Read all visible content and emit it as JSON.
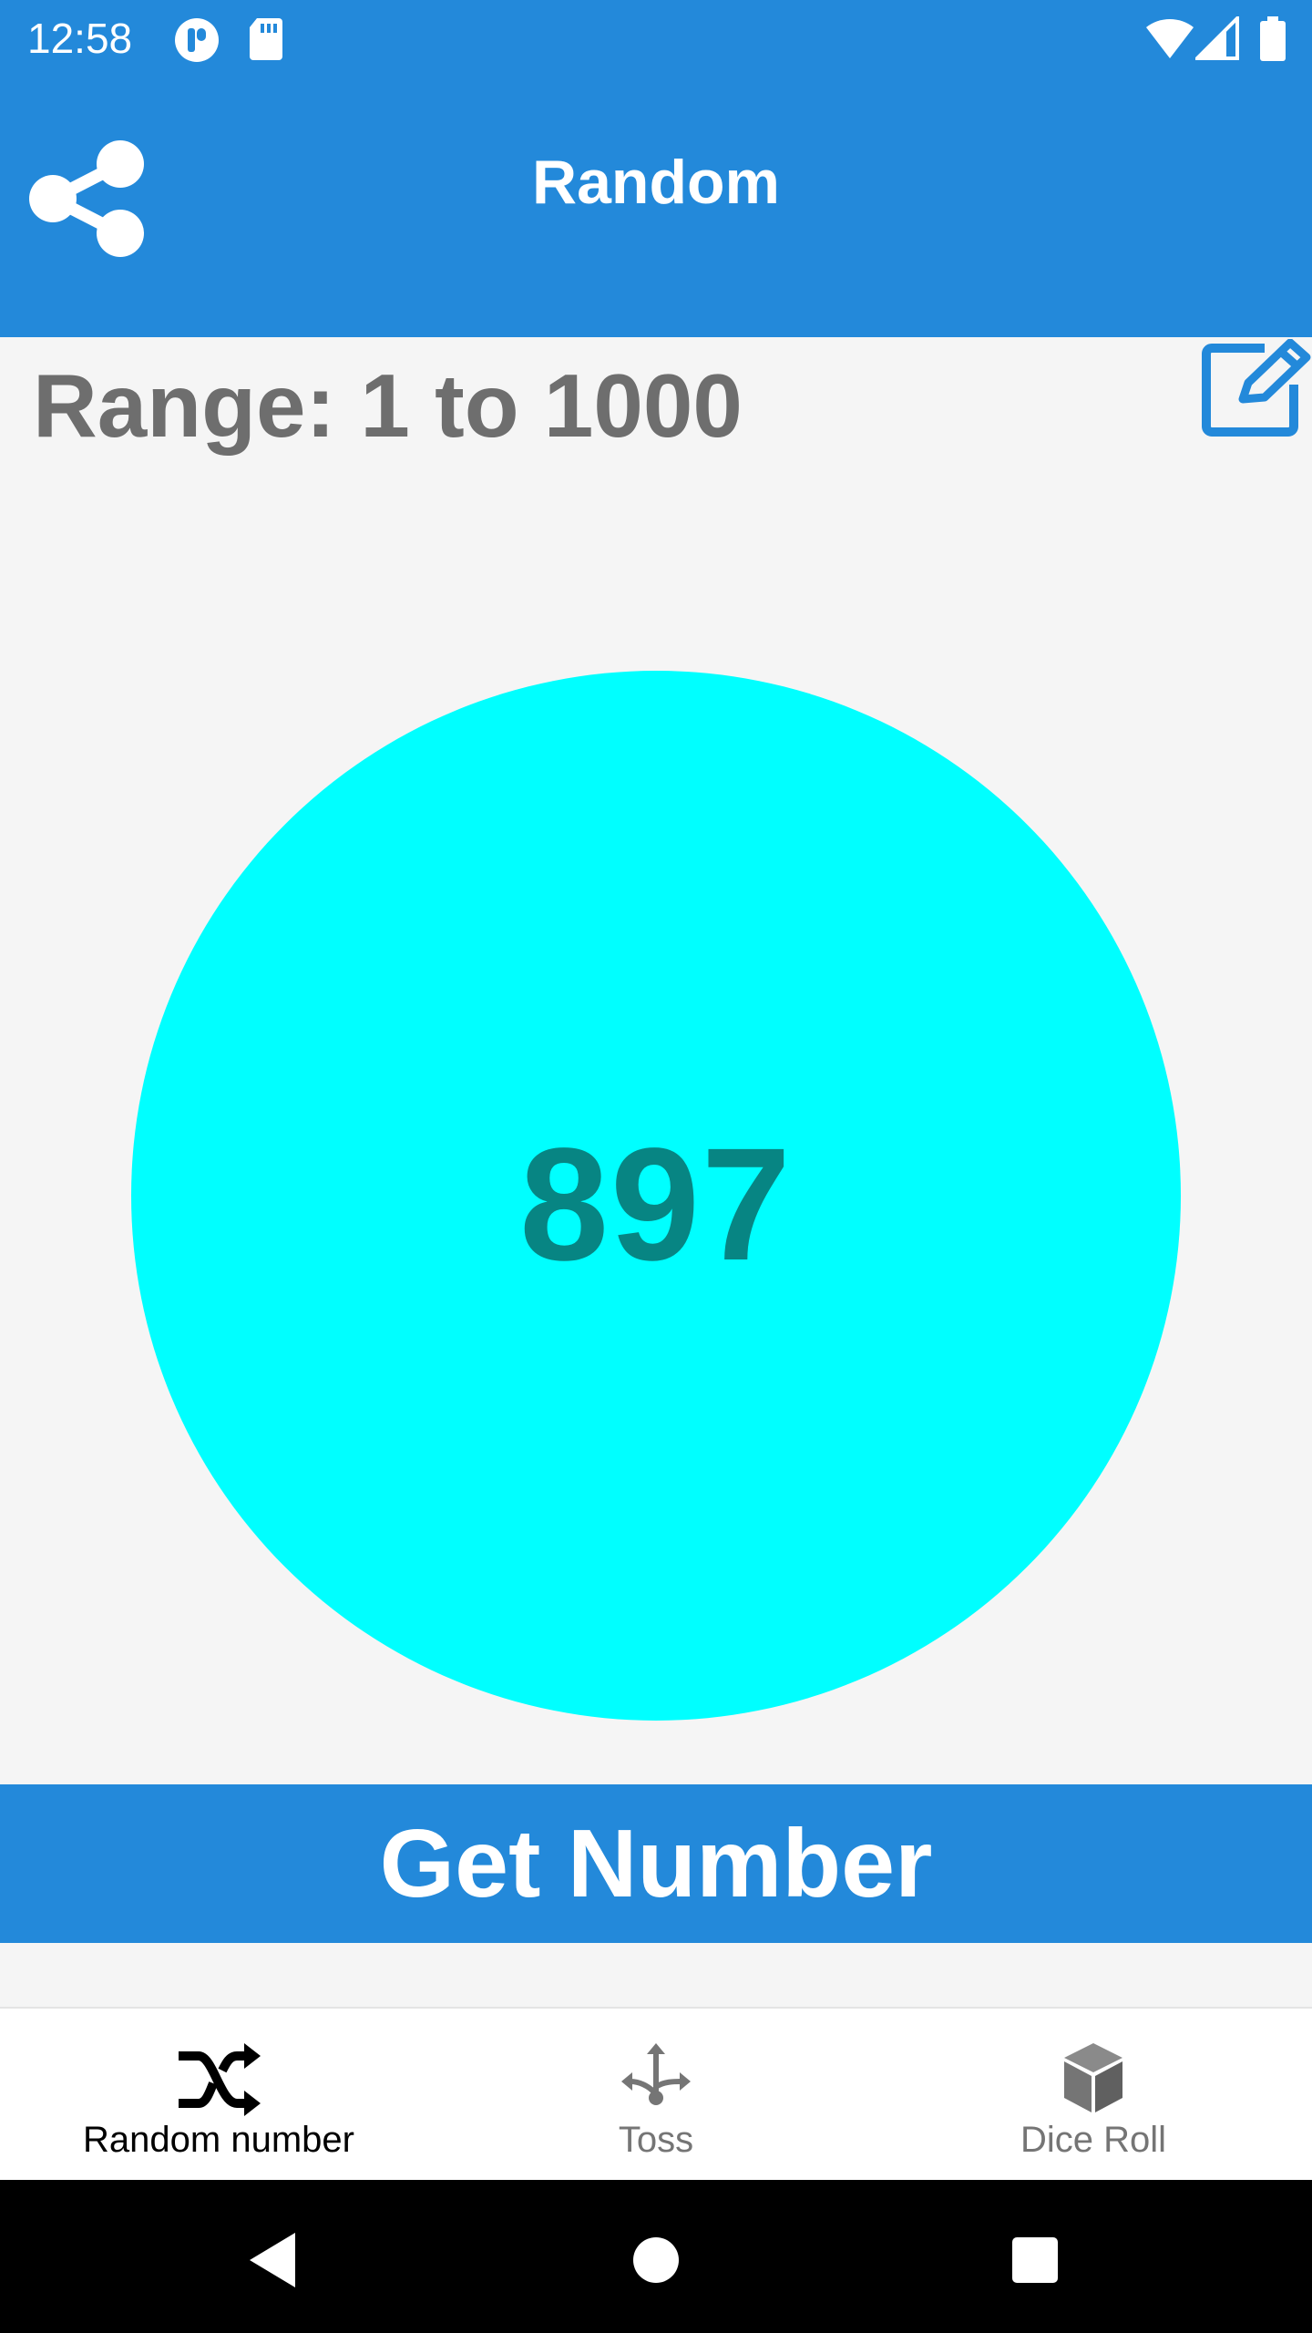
{
  "status_bar": {
    "time": "12:58",
    "icons": [
      "assistant-icon",
      "sd-card-icon",
      "wifi-icon",
      "signal-icon",
      "battery-icon"
    ]
  },
  "app_bar": {
    "title": "Random",
    "share_icon": "share-icon",
    "color": "#2389DA"
  },
  "range": {
    "label": "Range: 1 to 1000",
    "edit_icon": "edit-icon"
  },
  "result": {
    "value": "897",
    "circle_color": "#00FFFF",
    "text_color": "#078583"
  },
  "action": {
    "label": "Get Number"
  },
  "bottom_nav": {
    "items": [
      {
        "label": "Random number",
        "icon": "shuffle-icon",
        "selected": true
      },
      {
        "label": "Toss",
        "icon": "arrows-split-icon",
        "selected": false
      },
      {
        "label": "Dice Roll",
        "icon": "dice-cube-icon",
        "selected": false
      }
    ]
  },
  "system_nav": {
    "icons": [
      "back-icon",
      "home-icon",
      "recents-icon"
    ]
  }
}
